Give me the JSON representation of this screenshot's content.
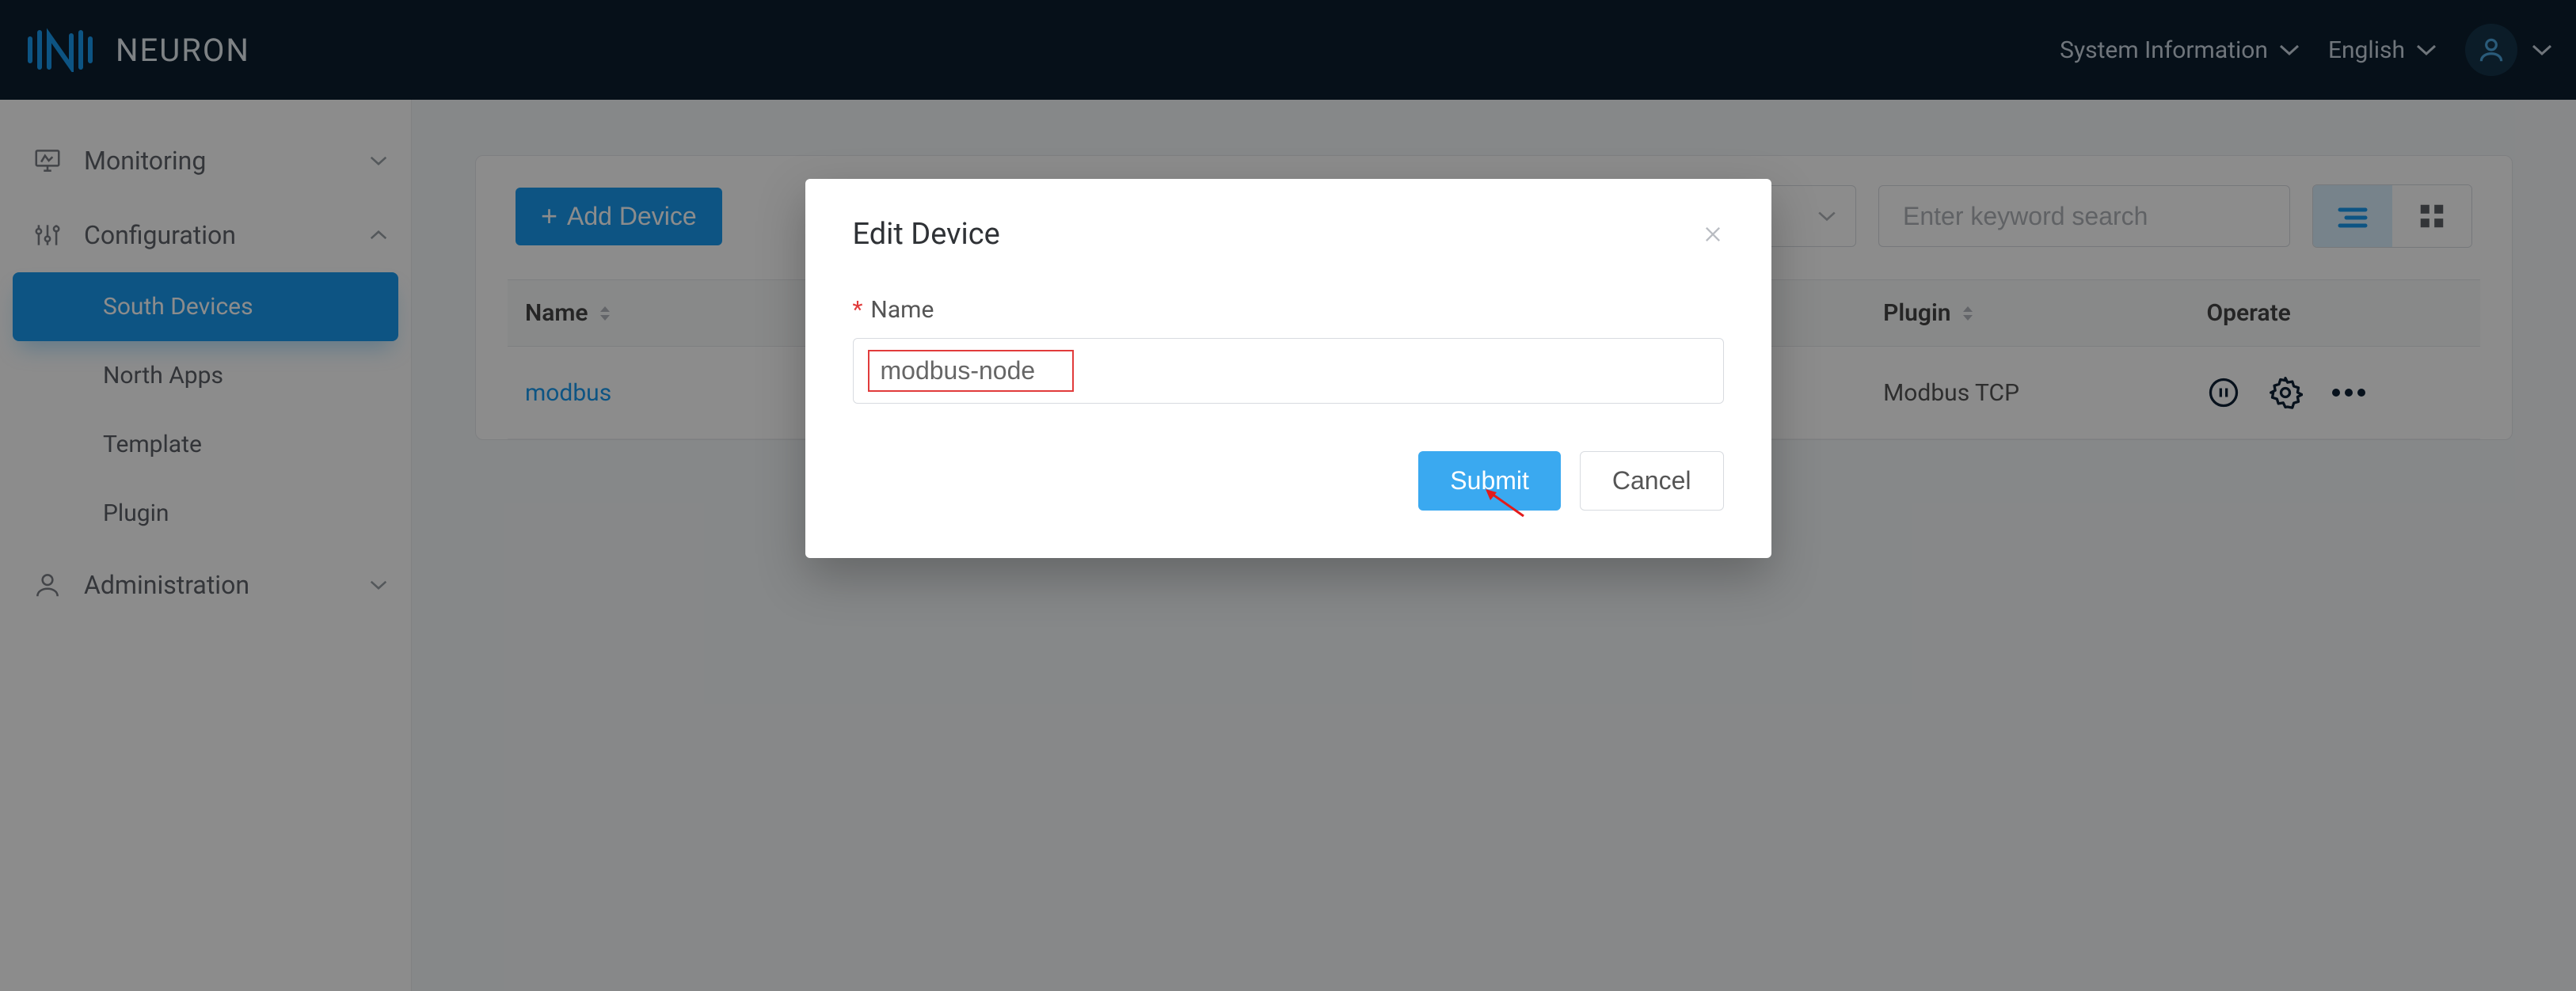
{
  "header": {
    "brand": "NEURON",
    "system_info_label": "System Information",
    "language_label": "English"
  },
  "sidebar": {
    "groups": [
      {
        "id": "monitoring",
        "label": "Monitoring"
      },
      {
        "id": "configuration",
        "label": "Configuration"
      },
      {
        "id": "administration",
        "label": "Administration"
      }
    ],
    "config_children": [
      {
        "id": "south-devices",
        "label": "South Devices",
        "active": true
      },
      {
        "id": "north-apps",
        "label": "North Apps"
      },
      {
        "id": "template",
        "label": "Template"
      },
      {
        "id": "plugin",
        "label": "Plugin"
      }
    ]
  },
  "toolbar": {
    "add_device_label": "Add Device",
    "search_placeholder": "Enter keyword search"
  },
  "table": {
    "columns": {
      "name": "Name",
      "plugin": "Plugin",
      "operate": "Operate"
    },
    "rows": [
      {
        "name": "modbus",
        "plugin": "Modbus TCP"
      }
    ]
  },
  "modal": {
    "title": "Edit Device",
    "fields": {
      "name_label": "Name",
      "name_value": "modbus-node"
    },
    "submit_label": "Submit",
    "cancel_label": "Cancel"
  }
}
